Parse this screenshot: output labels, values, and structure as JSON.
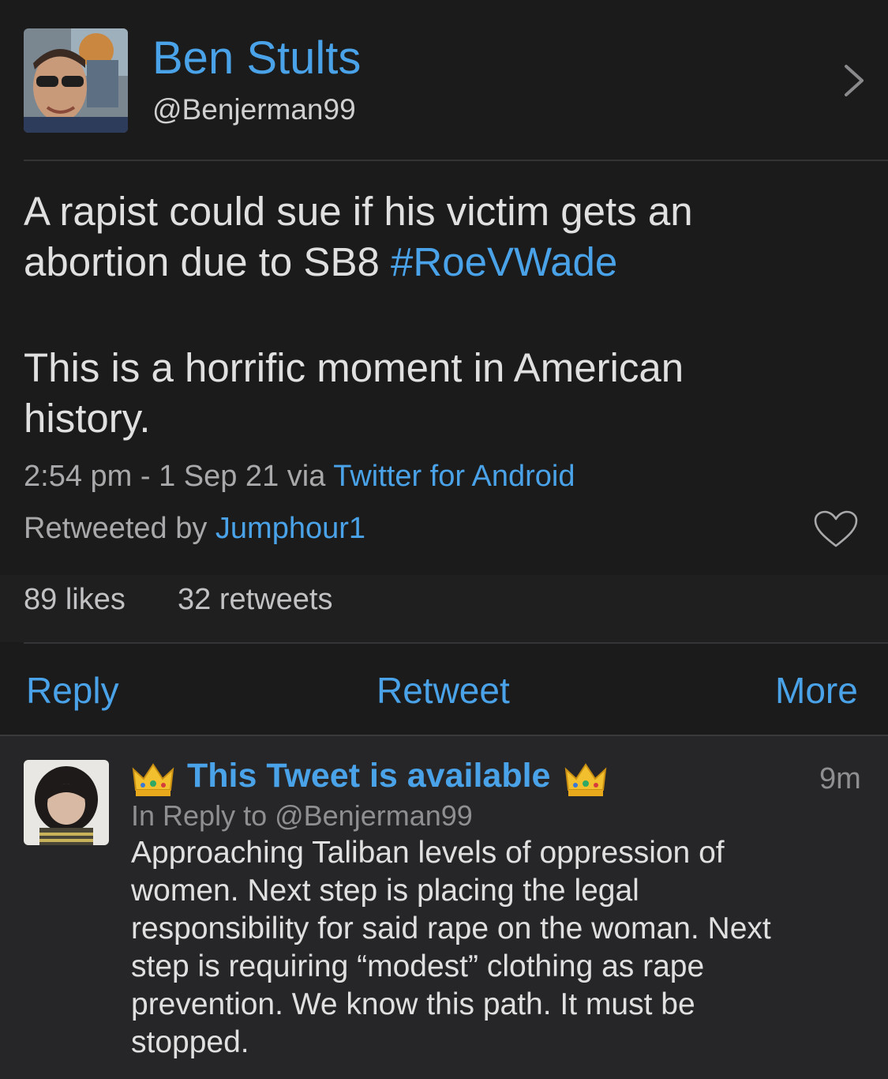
{
  "colors": {
    "accent": "#4aa3e8",
    "background": "#1b1b1c",
    "reply_background": "#262628"
  },
  "header": {
    "name": "Ben Stults",
    "handle": "@Benjerman99",
    "chevron_icon": "chevron-right-icon"
  },
  "tweet": {
    "line1": "A rapist could sue if his victim gets an",
    "line2_text": "abortion due to SB8 ",
    "hashtag": "#RoeVWade",
    "line3": "This is a horrific moment in American",
    "line4": "history.",
    "timestamp": "2:54 pm - 1 Sep 21 via ",
    "source": "Twitter for Android",
    "retweeted_by_label": "Retweeted by ",
    "retweeted_by_user": "Jumphour1",
    "like_icon": "heart-outline-icon"
  },
  "stats": {
    "likes": "89 likes",
    "retweets": "32 retweets"
  },
  "actions": {
    "reply": "Reply",
    "retweet": "Retweet",
    "more": "More"
  },
  "reply": {
    "name": "This Tweet is available",
    "crown_icon": "crown-icon",
    "time": "9m",
    "in_reply_to": "In Reply to @Benjerman99",
    "lines": [
      "Approaching Taliban levels of oppression of",
      "women. Next step is placing the legal",
      "responsibility for said rape on the woman. Next",
      "step is requiring “modest” clothing as rape",
      "prevention. We know this path. It must be",
      "stopped."
    ]
  }
}
